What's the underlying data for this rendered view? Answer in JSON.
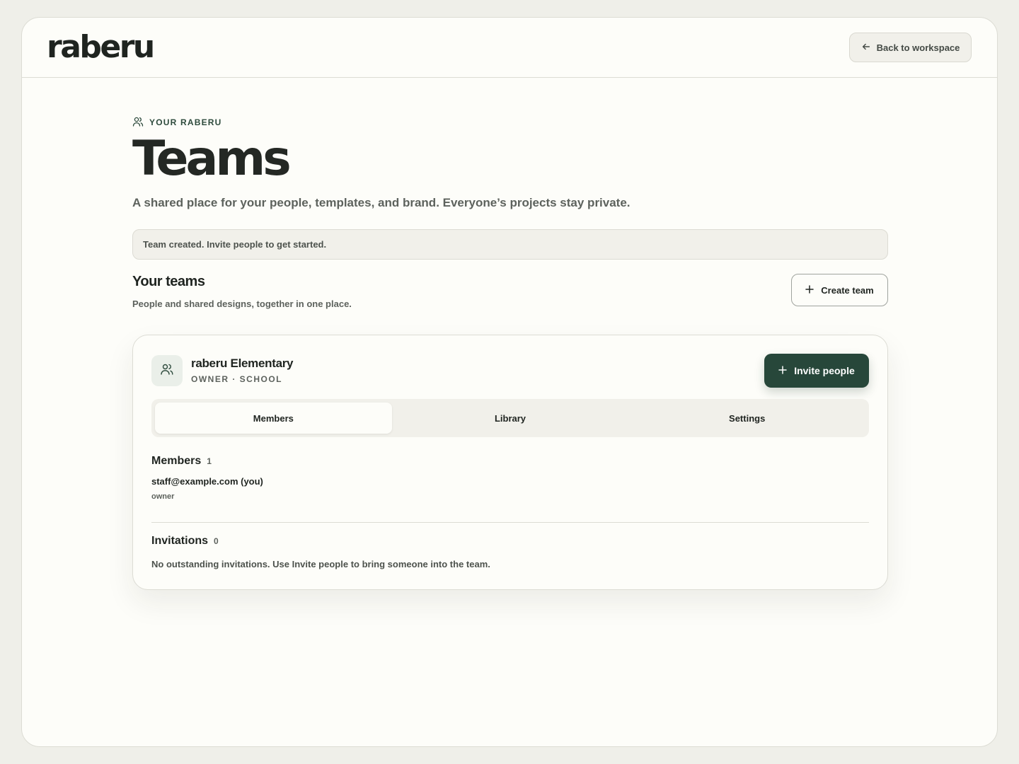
{
  "app": {
    "logo": "raberu"
  },
  "header": {
    "back_label": "Back to workspace"
  },
  "page": {
    "eyebrow": "YOUR RABERU",
    "title": "Teams",
    "subtitle": "A shared place for your people, templates, and brand. Everyone’s projects stay private."
  },
  "notice": {
    "text": "Team created. Invite people to get started."
  },
  "teams_section": {
    "title": "Your teams",
    "subtitle": "People and shared designs, together in one place.",
    "create_label": "Create team"
  },
  "team": {
    "name": "raberu Elementary",
    "meta": "OWNER · SCHOOL",
    "invite_label": "Invite people",
    "tabs": [
      {
        "label": "Members",
        "active": true
      },
      {
        "label": "Library",
        "active": false
      },
      {
        "label": "Settings",
        "active": false
      }
    ],
    "members": {
      "title": "Members",
      "count": "1",
      "items": [
        {
          "email": "staff@example.com (you)",
          "role": "owner"
        }
      ]
    },
    "invitations": {
      "title": "Invitations",
      "count": "0",
      "empty_text": "No outstanding invitations. Use Invite people to bring someone into the team."
    }
  },
  "icons": {
    "back": "arrow-left-icon",
    "eyebrow": "users-icon",
    "create": "plus-icon",
    "team": "users-icon",
    "invite": "plus-icon"
  },
  "colors": {
    "accent": "#27473a",
    "background": "#efefe9",
    "surface": "#fdfdf9",
    "muted_surface": "#f1f0ea"
  }
}
